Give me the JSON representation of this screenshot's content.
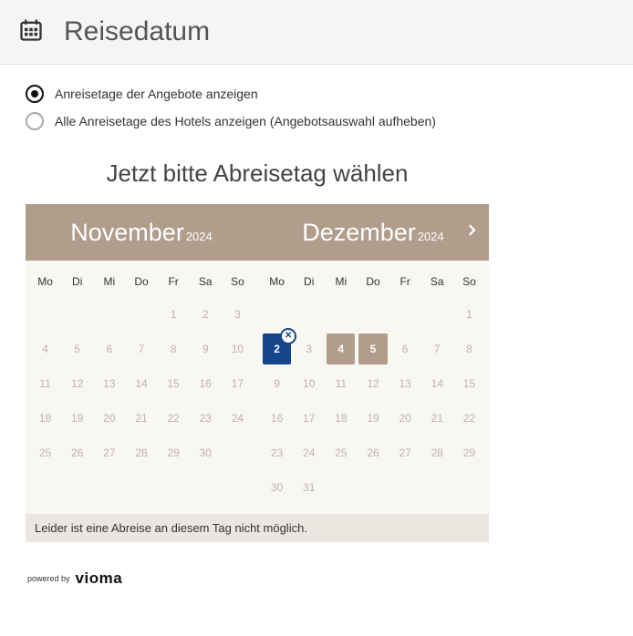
{
  "header": {
    "title": "Reisedatum"
  },
  "options": {
    "offer_days": "Anreisetage der Angebote anzeigen",
    "all_days": "Alle Anreisetage des Hotels anzeigen (Angebotsauswahl aufheben)",
    "selected": "offer_days"
  },
  "subheading": "Jetzt bitte Abreisetag wählen",
  "months": {
    "left": {
      "name": "November",
      "year": "2024"
    },
    "right": {
      "name": "Dezember",
      "year": "2024"
    }
  },
  "dow": [
    "Mo",
    "Di",
    "Mi",
    "Do",
    "Fr",
    "Sa",
    "So"
  ],
  "nov": {
    "offset": 4,
    "days": 30,
    "selected": null
  },
  "dec": {
    "offset": 6,
    "days": 31,
    "selected": 2,
    "avail": [
      4,
      5
    ]
  },
  "info": "Leider ist eine Abreise an diesem Tag nicht möglich.",
  "footer": {
    "powered": "powered by",
    "brand": "vioma"
  }
}
